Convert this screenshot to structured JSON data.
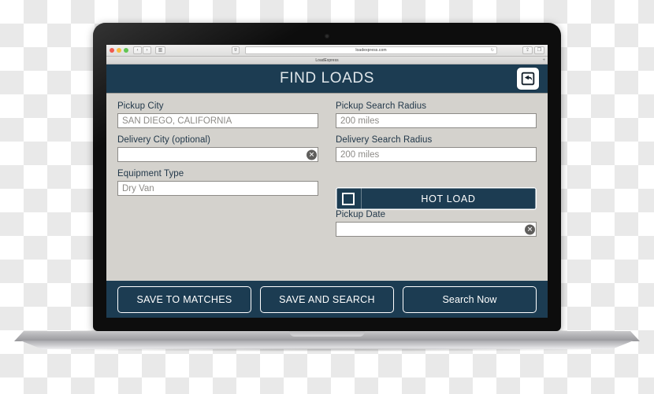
{
  "browser": {
    "url": "loadexpress.com",
    "tab_title": "LoadExpress",
    "reload_glyph": "↻",
    "back_glyph": "‹",
    "forward_glyph": "›",
    "sidebar_glyph": "▥",
    "shield_glyph": "⛨",
    "share_glyph": "⇪",
    "tabs_glyph": "❐",
    "new_tab_glyph": "+"
  },
  "app": {
    "title": "FIND LOADS",
    "back_icon": "back-arrow-icon",
    "fields": [
      {
        "key": "pickup_city",
        "label": "Pickup City",
        "value": "SAN DIEGO, CALIFORNIA",
        "has_clear": false
      },
      {
        "key": "pickup_search_radius",
        "label": "Pickup Search Radius",
        "value": "200 miles",
        "has_clear": false
      },
      {
        "key": "delivery_city",
        "label": "Delivery City (optional)",
        "value": "",
        "has_clear": true
      },
      {
        "key": "delivery_search_radius",
        "label": "Delivery Search Radius",
        "value": "200 miles",
        "has_clear": false
      },
      {
        "key": "equipment_type",
        "label": "Equipment Type",
        "value": "Dry Van",
        "has_clear": false
      },
      {
        "key": "pickup_date",
        "label": "Pickup Date",
        "value": "",
        "has_clear": true
      }
    ],
    "hot_load": {
      "label": "HOT LOAD",
      "checked": false
    },
    "actions": {
      "save_to_matches": "SAVE TO MATCHES",
      "save_and_search": "SAVE AND SEARCH",
      "search_now": "Search Now"
    },
    "clear_glyph": "✕"
  },
  "colors": {
    "navy": "#1c3c52",
    "body": "#d4d2cd",
    "label_text": "#22384a",
    "input_text": "#8d8b87"
  }
}
